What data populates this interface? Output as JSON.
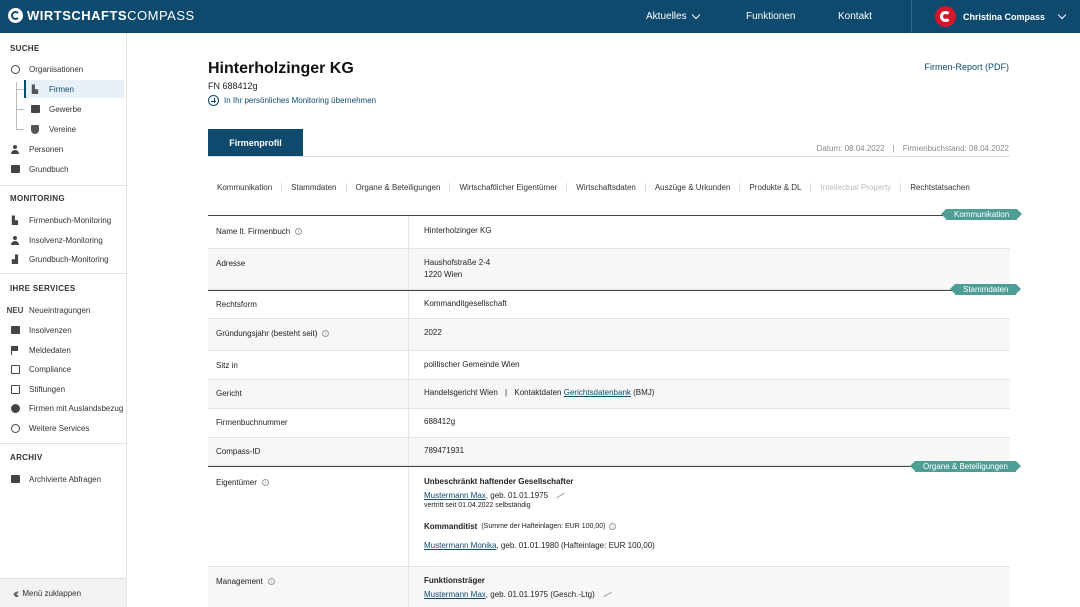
{
  "header": {
    "logo_bold": "WIRTSCHAFTS",
    "logo_light": "COMPASS",
    "nav": [
      "Aktuelles",
      "Funktionen",
      "Kontakt"
    ],
    "user_name": "Christina Compass"
  },
  "sidebar": {
    "suche_title": "SUCHE",
    "organisationen": "Organisationen",
    "firmen": "Firmen",
    "gewerbe": "Gewerbe",
    "vereine": "Vereine",
    "personen": "Personen",
    "grundbuch": "Grundbuch",
    "monitoring_title": "MONITORING",
    "firmenbuch_monitoring": "Firmenbuch-Monitoring",
    "insolvenz_monitoring": "Insolvenz-Monitoring",
    "grundbuch_monitoring": "Grundbuch-Monitoring",
    "services_title": "IHRE SERVICES",
    "neu_badge": "NEU",
    "neueintragungen": "Neueintragungen",
    "insolvenzen": "Insolvenzen",
    "meldedaten": "Meldedaten",
    "compliance": "Compliance",
    "stiftungen": "Stiftungen",
    "auslandsbezug": "Firmen mit Auslandsbezug",
    "weitere": "Weitere Services",
    "archiv_title": "ARCHIV",
    "archivierte": "Archivierte Abfragen",
    "collapse": "Menü zuklappen"
  },
  "company": {
    "name": "Hinterholzinger KG",
    "fn": "FN 688412g",
    "monitor_link": "In Ihr persönliches Monitoring übernehmen",
    "report_link": "Firmen-Report (PDF)",
    "profile_tab": "Firmenprofil",
    "datum": "Datum: 08.04.2022",
    "separator": "|",
    "firmenbuchstand": "Firmenbuchstand: 08.04.2022"
  },
  "sections": [
    "Kommunikation",
    "Stammdaten",
    "Organe & Beteiligungen",
    "Wirtschaftlicher Eigentümer",
    "Wirtschaftsdaten",
    "Auszüge & Urkunden",
    "Produkte & DL",
    "Intellectual Property",
    "Rechtstatsachen"
  ],
  "ribbons": {
    "kommunikation": "Kommunikation",
    "stammdaten": "Stammdaten",
    "organe": "Organe & Beteiligungen"
  },
  "rows": {
    "name_label": "Name lt. Firmenbuch",
    "name_value": "Hinterholzinger KG",
    "adresse_label": "Adresse",
    "adresse_line1": "Haushofstraße 2-4",
    "adresse_line2": "1220 Wien",
    "rechtsform_label": "Rechtsform",
    "rechtsform_value": "Kommanditgesellschaft",
    "gruendung_label": "Gründungsjahr (besteht seit)",
    "gruendung_value": "2022",
    "sitz_label": "Sitz in",
    "sitz_value": "politischer Gemeinde Wien",
    "gericht_label": "Gericht",
    "gericht_value": "Handelsgericht Wien",
    "gericht_sep": "|",
    "gericht_kontakt": "Kontaktdaten",
    "gericht_link": "Gerichtsdatenbank",
    "gericht_bmj": "(BMJ)",
    "fbn_label": "Firmenbuchnummer",
    "fbn_value": "688412g",
    "compass_label": "Compass-ID",
    "compass_value": "789471931",
    "eigentuemer_label": "Eigentümer",
    "unbeschraenkt_title": "Unbeschränkt haftender Gesellschafter",
    "owner1_link": "Mustermann Max",
    "owner1_geb": ", geb. 01.01.1975",
    "owner1_note": "vertritt seit 01.04.2022 selbständig",
    "kommanditist_title": "Kommanditist",
    "kommanditist_sum": "(Summe der Hafteinlagen: EUR 100,00)",
    "owner2_link": "Mustermann Monika",
    "owner2_geb": ", geb. 01.01.1980 (Hafteinlage: EUR 100,00)",
    "management_label": "Management",
    "funktionstraeger_title": "Funktionsträger",
    "mgmt1_link": "Mustermann Max",
    "mgmt1_geb": ", geb. 01.01.1975 (Gesch.-Ltg)"
  },
  "colors": {
    "brand": "#0e4a6e",
    "accent_red": "#d3182d",
    "ribbon_teal": "#4d9f95"
  }
}
